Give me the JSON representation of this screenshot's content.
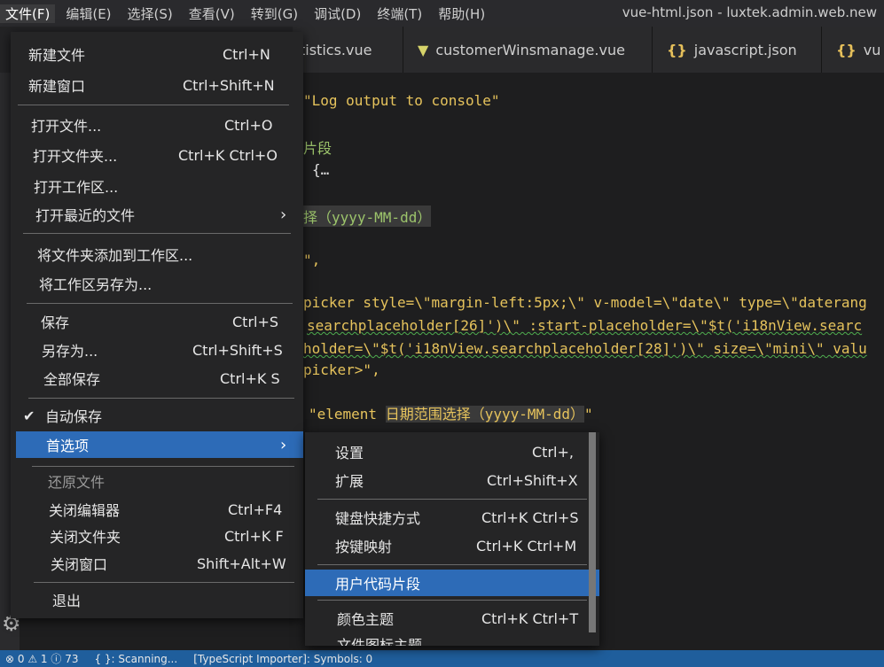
{
  "menubar": {
    "items": [
      "文件(F)",
      "编辑(E)",
      "选择(S)",
      "查看(V)",
      "转到(G)",
      "调试(D)",
      "终端(T)",
      "帮助(H)"
    ],
    "window_title": "vue-html.json - luxtek.admin.web.new"
  },
  "tabs": [
    {
      "label": "tistics.vue",
      "icon": "vue-icon"
    },
    {
      "label": "customerWinsmanage.vue",
      "icon": "vue-icon"
    },
    {
      "label": "javascript.json",
      "icon": "json-icon"
    },
    {
      "label": "vu",
      "icon": "json-icon"
    }
  ],
  "editor": {
    "line1": "\"Log output to console\"",
    "line2": "片段",
    "line3": "{…",
    "line4": "择（yyyy-MM-dd）",
    "line5": "\",",
    "line6a": "picker style=\\\"margin-left:5px;\\\" v-model=\\\"date\\\" type=\\\"daterang",
    "line7": "searchplaceholder[26]')\\\" :start-placeholder=\\\"$t('i18nView.searc",
    "line8": "holder=\\\"$t('i18nView.searchplaceholder[28]')\\\" size=\\\"mini\\\" valu",
    "line9": "picker>\",",
    "line10a": "\"element ",
    "line10b": "日期范围选择（yyyy-MM-dd）",
    "line10c": "\""
  },
  "file_menu": {
    "items": [
      {
        "label": "新建文件",
        "shortcut": "Ctrl+N"
      },
      {
        "label": "新建窗口",
        "shortcut": "Ctrl+Shift+N"
      },
      {
        "label": "打开文件...",
        "shortcut": "Ctrl+O"
      },
      {
        "label": "打开文件夹...",
        "shortcut": "Ctrl+K Ctrl+O"
      },
      {
        "label": "打开工作区...",
        "shortcut": ""
      },
      {
        "label": "打开最近的文件",
        "shortcut": ""
      },
      {
        "label": "将文件夹添加到工作区...",
        "shortcut": ""
      },
      {
        "label": "将工作区另存为...",
        "shortcut": ""
      },
      {
        "label": "保存",
        "shortcut": "Ctrl+S"
      },
      {
        "label": "另存为...",
        "shortcut": "Ctrl+Shift+S"
      },
      {
        "label": "全部保存",
        "shortcut": "Ctrl+K S"
      },
      {
        "label": "自动保存",
        "shortcut": ""
      },
      {
        "label": "首选项",
        "shortcut": ""
      },
      {
        "label": "还原文件",
        "shortcut": ""
      },
      {
        "label": "关闭编辑器",
        "shortcut": "Ctrl+F4"
      },
      {
        "label": "关闭文件夹",
        "shortcut": "Ctrl+K F"
      },
      {
        "label": "关闭窗口",
        "shortcut": "Shift+Alt+W"
      },
      {
        "label": "退出",
        "shortcut": ""
      }
    ],
    "check_glyph": "✔"
  },
  "prefs_menu": {
    "items": [
      {
        "label": "设置",
        "shortcut": "Ctrl+,"
      },
      {
        "label": "扩展",
        "shortcut": "Ctrl+Shift+X"
      },
      {
        "label": "键盘快捷方式",
        "shortcut": "Ctrl+K Ctrl+S"
      },
      {
        "label": "按键映射",
        "shortcut": "Ctrl+K Ctrl+M"
      },
      {
        "label": "用户代码片段",
        "shortcut": ""
      },
      {
        "label": "颜色主题",
        "shortcut": "Ctrl+K Ctrl+T"
      },
      {
        "label": "文件图标主题",
        "shortcut": ""
      }
    ]
  },
  "statusbar": {
    "errors": "0",
    "warnings": "1",
    "count": "73",
    "scanning": "{ }: Scanning...",
    "ts": "[TypeScript Importer]: Symbols: 0"
  },
  "colors": {
    "accent": "#2d6bb7",
    "statusbar": "#1f5e9c"
  }
}
